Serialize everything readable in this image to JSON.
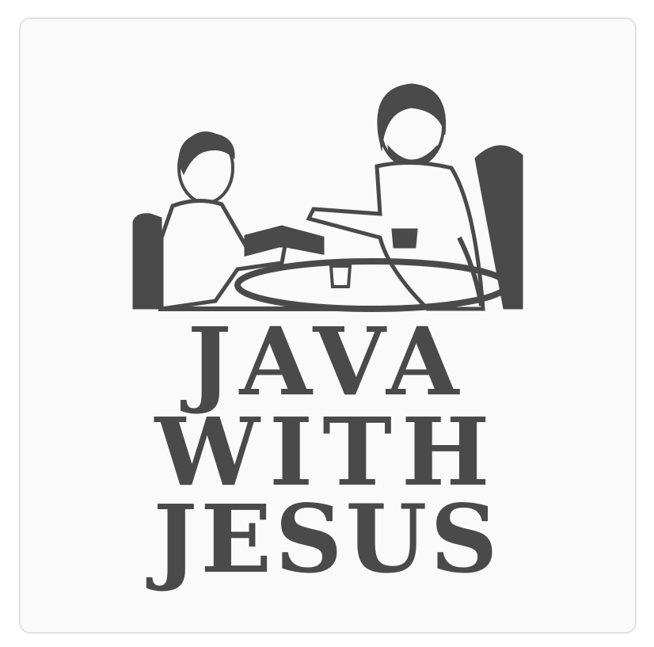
{
  "card": {
    "title_lines": [
      "JAVA",
      "WITH",
      "JESUS"
    ],
    "illustration": "two-men-at-table-with-bible-and-coffee",
    "ink_color": "#4a4a4a",
    "paper_color": "#fafafa"
  }
}
